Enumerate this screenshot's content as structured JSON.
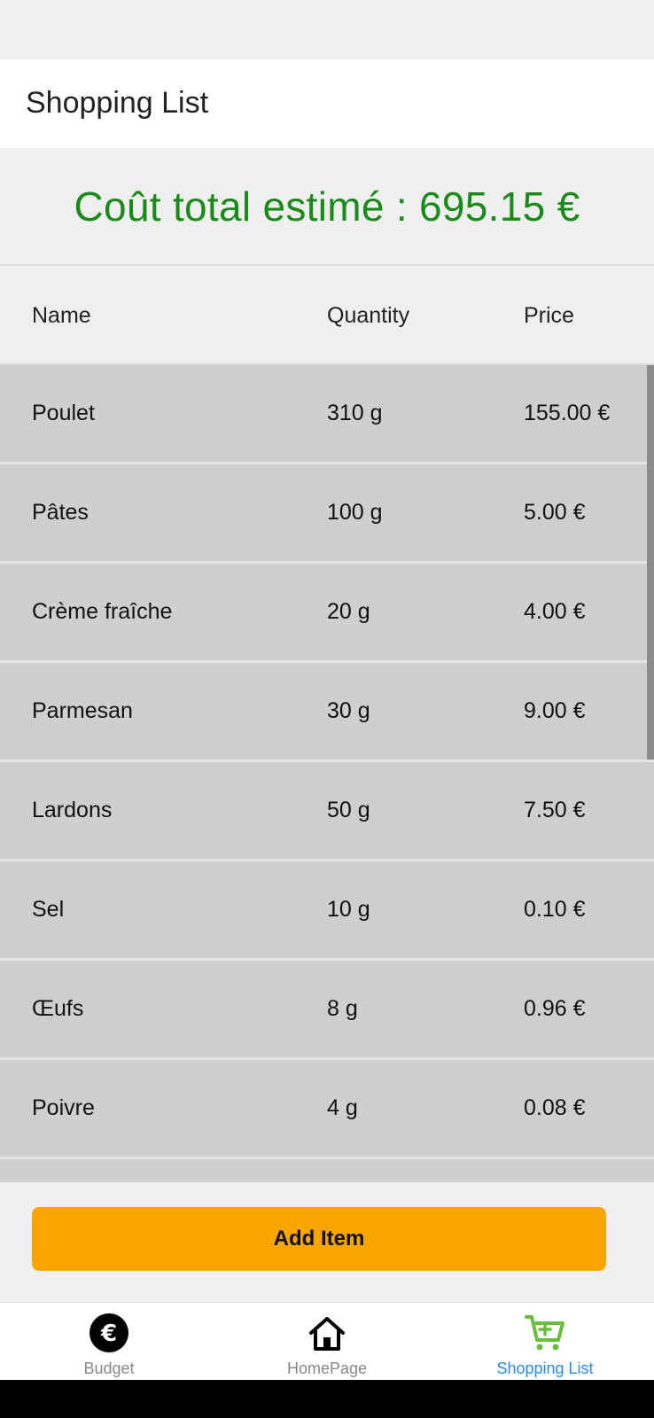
{
  "app_bar": {
    "title": "Shopping List"
  },
  "total": {
    "text": "Coût total estimé : 695.15 €"
  },
  "table": {
    "headers": {
      "name": "Name",
      "quantity": "Quantity",
      "price": "Price"
    },
    "rows": [
      {
        "name": "Poulet",
        "quantity": "310 g",
        "price": "155.00 €"
      },
      {
        "name": "Pâtes",
        "quantity": "100 g",
        "price": "5.00 €"
      },
      {
        "name": "Crème fraîche",
        "quantity": "20 g",
        "price": "4.00 €"
      },
      {
        "name": "Parmesan",
        "quantity": "30 g",
        "price": "9.00 €"
      },
      {
        "name": "Lardons",
        "quantity": "50 g",
        "price": "7.50 €"
      },
      {
        "name": "Sel",
        "quantity": "10 g",
        "price": "0.10 €"
      },
      {
        "name": "Œufs",
        "quantity": "8 g",
        "price": "0.96 €"
      },
      {
        "name": "Poivre",
        "quantity": "4 g",
        "price": "0.08 €"
      }
    ]
  },
  "actions": {
    "add_item_label": "Add Item"
  },
  "bottom_nav": {
    "items": [
      {
        "label": "Budget",
        "icon": "euro-icon",
        "active": false
      },
      {
        "label": "HomePage",
        "icon": "home-icon",
        "active": false
      },
      {
        "label": "Shopping List",
        "icon": "cart-icon",
        "active": true
      }
    ]
  },
  "colors": {
    "total_green": "#1a8a1a",
    "accent_orange": "#f9a500",
    "active_blue": "#2a8ce4",
    "cart_green": "#6abf3a"
  }
}
